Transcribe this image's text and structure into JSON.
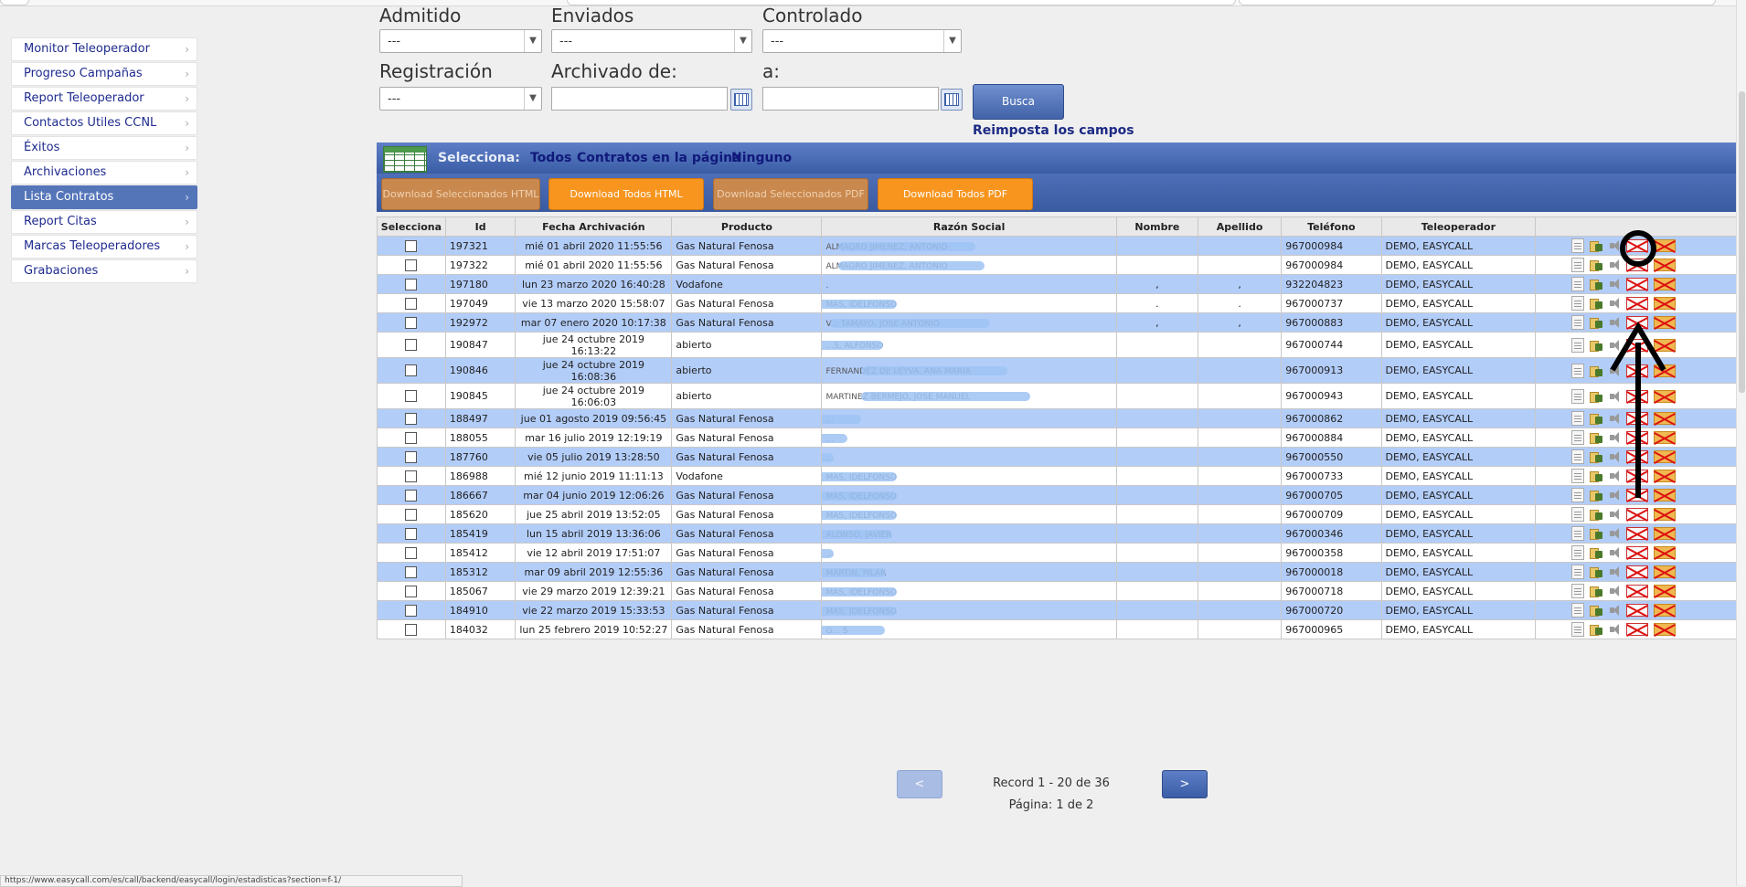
{
  "sidebar": {
    "items": [
      {
        "label": "Monitor Teleoperador",
        "active": false
      },
      {
        "label": "Progreso Campañas",
        "active": false
      },
      {
        "label": "Report Teleoperador",
        "active": false
      },
      {
        "label": "Contactos Utiles CCNL",
        "active": false
      },
      {
        "label": "Éxitos",
        "active": false
      },
      {
        "label": "Archivaciones",
        "active": false
      },
      {
        "label": "Lista Contratos",
        "active": true
      },
      {
        "label": "Report Citas",
        "active": false
      },
      {
        "label": "Marcas Teleoperadores",
        "active": false
      },
      {
        "label": "Grabaciones",
        "active": false
      }
    ]
  },
  "filters": {
    "admitido_label": "Admitido",
    "admitido_value": "---",
    "enviados_label": "Enviados",
    "enviados_value": "---",
    "controlado_label": "Controlado",
    "controlado_value": "---",
    "registracion_label": "Registración",
    "registracion_value": "---",
    "archivado_de_label": "Archivado de:",
    "archivado_a_label": "a:",
    "busca_label": "Busca",
    "reset_label": "Reimposta los campos"
  },
  "selection": {
    "label": "Selecciona:",
    "todos": "Todos",
    "pagina": "Contratos en la página",
    "ninguno": "Ninguno"
  },
  "downloads": {
    "sel_html": "Download Seleccionados HTML",
    "all_html": "Download Todos HTML",
    "sel_pdf": "Download Seleccionados PDF",
    "all_pdf": "Download Todos PDF"
  },
  "table": {
    "headers": [
      "Selecciona",
      "Id",
      "Fecha Archivación",
      "Producto",
      "Razón Social",
      "Nombre",
      "Apellido",
      "Teléfono",
      "Teleoperador",
      ""
    ],
    "rows": [
      {
        "id": "197321",
        "fecha": "mié 01 abril 2020 11:55:56",
        "producto": "Gas Natural Fenosa",
        "razon": "ALMAGRO JIMENEZ, ANTONIO",
        "nombre": "",
        "apellido": "",
        "telefono": "967000984",
        "teleoperador": "DEMO, EASYCALL"
      },
      {
        "id": "197322",
        "fecha": "mié 01 abril 2020 11:55:56",
        "producto": "Gas Natural Fenosa",
        "razon": "ALMAGRO JIMENEZ, ANTONIO",
        "nombre": "",
        "apellido": "",
        "telefono": "967000984",
        "teleoperador": "DEMO, EASYCALL"
      },
      {
        "id": "197180",
        "fecha": "lun 23 marzo 2020 16:40:28",
        "producto": "Vodafone",
        "razon": ".",
        "nombre": ",",
        "apellido": ",",
        "telefono": "932204823",
        "teleoperador": "DEMO, EASYCALL"
      },
      {
        "id": "197049",
        "fecha": "vie 13 marzo 2020 15:58:07",
        "producto": "Gas Natural Fenosa",
        "razon": "MAS, IDELFONSO",
        "nombre": ".",
        "apellido": ".",
        "telefono": "967000737",
        "teleoperador": "DEMO, EASYCALL"
      },
      {
        "id": "192972",
        "fecha": "mar 07 enero 2020 10:17:38",
        "producto": "Gas Natural Fenosa",
        "razon": "V... TAMAYO, JOSE ANTONIO",
        "nombre": ",",
        "apellido": ",",
        "telefono": "967000883",
        "teleoperador": "DEMO, EASYCALL"
      },
      {
        "id": "190847",
        "fecha": "jue 24 octubre 2019 16:13:22",
        "producto": "abierto",
        "razon": "...S, ALFONSO",
        "nombre": "",
        "apellido": "",
        "telefono": "967000744",
        "teleoperador": "DEMO, EASYCALL"
      },
      {
        "id": "190846",
        "fecha": "jue 24 octubre 2019 16:08:36",
        "producto": "abierto",
        "razon": "FERNANDEZ DE LEYVA, ANA MARIA",
        "nombre": "",
        "apellido": "",
        "telefono": "967000913",
        "teleoperador": "DEMO, EASYCALL"
      },
      {
        "id": "190845",
        "fecha": "jue 24 octubre 2019 16:06:03",
        "producto": "abierto",
        "razon": "MARTINEZ BERMEJO, JOSE MANUEL",
        "nombre": "",
        "apellido": "",
        "telefono": "967000943",
        "teleoperador": "DEMO, EASYCALL"
      },
      {
        "id": "188497",
        "fecha": "jue 01 agosto 2019 09:56:45",
        "producto": "Gas Natural Fenosa",
        "razon": "...",
        "nombre": "",
        "apellido": "",
        "telefono": "967000862",
        "teleoperador": "DEMO, EASYCALL"
      },
      {
        "id": "188055",
        "fecha": "mar 16 julio 2019 12:19:19",
        "producto": "Gas Natural Fenosa",
        "razon": "...",
        "nombre": "",
        "apellido": "",
        "telefono": "967000884",
        "teleoperador": "DEMO, EASYCALL"
      },
      {
        "id": "187760",
        "fecha": "vie 05 julio 2019 13:28:50",
        "producto": "Gas Natural Fenosa",
        "razon": "...",
        "nombre": "",
        "apellido": "",
        "telefono": "967000550",
        "teleoperador": "DEMO, EASYCALL"
      },
      {
        "id": "186988",
        "fecha": "mié 12 junio 2019 11:11:13",
        "producto": "Vodafone",
        "razon": "MAS, IDELFONSO",
        "nombre": "",
        "apellido": "",
        "telefono": "967000733",
        "teleoperador": "DEMO, EASYCALL"
      },
      {
        "id": "186667",
        "fecha": "mar 04 junio 2019 12:06:26",
        "producto": "Gas Natural Fenosa",
        "razon": "MAS, IDELFONSO",
        "nombre": "",
        "apellido": "",
        "telefono": "967000705",
        "teleoperador": "DEMO, EASYCALL"
      },
      {
        "id": "185620",
        "fecha": "jue 25 abril 2019 13:52:05",
        "producto": "Gas Natural Fenosa",
        "razon": "MAS, IDELFONSO",
        "nombre": "",
        "apellido": "",
        "telefono": "967000709",
        "teleoperador": "DEMO, EASYCALL"
      },
      {
        "id": "185419",
        "fecha": "lun 15 abril 2019 13:36:06",
        "producto": "Gas Natural Fenosa",
        "razon": "ALONSO, JAVIER",
        "nombre": "",
        "apellido": "",
        "telefono": "967000346",
        "teleoperador": "DEMO, EASYCALL"
      },
      {
        "id": "185412",
        "fecha": "vie 12 abril 2019 17:51:07",
        "producto": "Gas Natural Fenosa",
        "razon": "...",
        "nombre": "",
        "apellido": "",
        "telefono": "967000358",
        "teleoperador": "DEMO, EASYCALL"
      },
      {
        "id": "185312",
        "fecha": "mar 09 abril 2019 12:55:36",
        "producto": "Gas Natural Fenosa",
        "razon": "MARTIN, PILAR",
        "nombre": "",
        "apellido": "",
        "telefono": "967000018",
        "teleoperador": "DEMO, EASYCALL"
      },
      {
        "id": "185067",
        "fecha": "vie 29 marzo 2019 12:39:21",
        "producto": "Gas Natural Fenosa",
        "razon": "MAS, IDELFONSO",
        "nombre": "",
        "apellido": "",
        "telefono": "967000718",
        "teleoperador": "DEMO, EASYCALL"
      },
      {
        "id": "184910",
        "fecha": "vie 22 marzo 2019 15:33:53",
        "producto": "Gas Natural Fenosa",
        "razon": "MAS, IDELFONSO",
        "nombre": "",
        "apellido": "",
        "telefono": "967000720",
        "teleoperador": "DEMO, EASYCALL"
      },
      {
        "id": "184032",
        "fecha": "lun 25 febrero 2019 10:52:27",
        "producto": "Gas Natural Fenosa",
        "razon": "G... S",
        "nombre": "",
        "apellido": "",
        "telefono": "967000965",
        "teleoperador": "DEMO, EASYCALL"
      }
    ]
  },
  "pagination": {
    "prev": "<",
    "next": ">",
    "record": "Record 1 - 20 de 36",
    "page": "Página: 1 de 2"
  },
  "statusbar": "https://www.easycall.com/es/call/backend/easycall/login/estadisticas?section=f-1/"
}
